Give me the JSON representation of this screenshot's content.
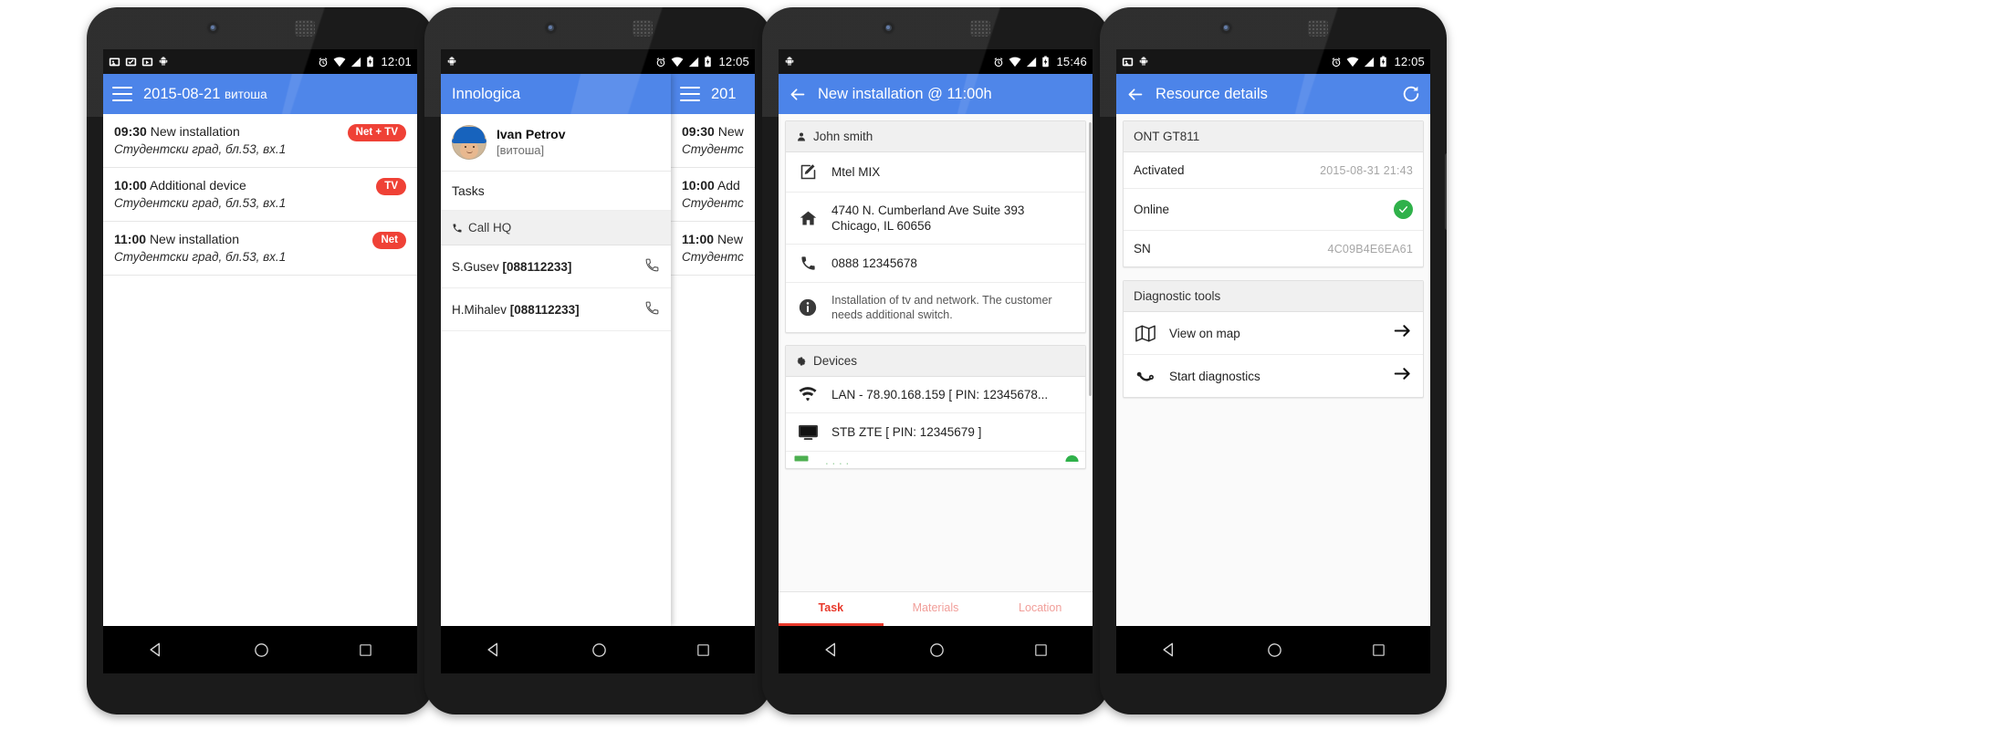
{
  "phones": [
    {
      "id": "tasks-list",
      "status": {
        "clock": "12:01",
        "left_icons": [
          "photo-icon",
          "photo-check-icon",
          "photo-video-icon",
          "android-icon"
        ],
        "right_icons": [
          "alarm-icon",
          "wifi-icon",
          "signal-icon",
          "battery-charging-icon"
        ]
      },
      "appbar": {
        "menu": "menu-icon",
        "title": "2015-08-21",
        "subtitle": "витоша"
      },
      "tasks": [
        {
          "time": "09:30",
          "title": "New installation",
          "address": "Студентски град, бл.53, вх.1",
          "badge": "Net + TV"
        },
        {
          "time": "10:00",
          "title": "Additional device",
          "address": "Студентски град, бл.53, вх.1",
          "badge": "TV"
        },
        {
          "time": "11:00",
          "title": "New installation",
          "address": "Студентски град, бл.53, вх.1",
          "badge": "Net"
        }
      ]
    },
    {
      "id": "nav-drawer",
      "status": {
        "clock": "12:05"
      },
      "drawer": {
        "brand": "Innologica",
        "profile": {
          "name": "Ivan Petrov",
          "team": "[витоша]"
        },
        "items": [
          {
            "label": "Tasks"
          }
        ],
        "section": {
          "label": "Call HQ",
          "icon": "phone-icon"
        },
        "contacts": [
          {
            "name": "S.Gusev",
            "phone": "[088112233]"
          },
          {
            "name": "H.Mihalev",
            "phone": "[088112233]"
          }
        ]
      },
      "appbar": {
        "menu": "menu-icon",
        "title": "201"
      },
      "tasks": [
        {
          "time": "09:30",
          "title": "New",
          "address": "Студентс"
        },
        {
          "time": "10:00",
          "title": "Add",
          "address": "Студентс"
        },
        {
          "time": "11:00",
          "title": "New",
          "address": "Студентс"
        }
      ]
    },
    {
      "id": "task-detail",
      "status": {
        "clock": "15:46"
      },
      "appbar": {
        "back": "back-arrow-icon",
        "title": "New installation @ 11:00h"
      },
      "customer_card": {
        "header": {
          "label": "John smith",
          "icon": "person-icon"
        },
        "rows": [
          {
            "icon": "edit-icon",
            "text": "Mtel MIX"
          },
          {
            "icon": "home-icon",
            "text": "4740 N. Cumberland Ave Suite 393\nChicago, IL 60656"
          },
          {
            "icon": "phone-icon",
            "text": "0888 12345678"
          },
          {
            "icon": "info-icon",
            "text": "Installation of tv and network. The customer needs additional switch."
          }
        ]
      },
      "devices_card": {
        "header": {
          "label": "Devices",
          "icon": "gear-icon"
        },
        "rows": [
          {
            "icon": "wifi-icon",
            "text": "LAN - 78.90.168.159 [ PIN: 12345678..."
          },
          {
            "icon": "tv-icon",
            "text": "STB ZTE [ PIN: 12345679 ]"
          }
        ]
      },
      "tabs": [
        {
          "label": "Task",
          "active": true
        },
        {
          "label": "Materials",
          "active": false
        },
        {
          "label": "Location",
          "active": false
        }
      ]
    },
    {
      "id": "resource-details",
      "status": {
        "clock": "12:05"
      },
      "appbar": {
        "back": "back-arrow-icon",
        "title": "Resource details",
        "action": "refresh-icon"
      },
      "resource_card": {
        "header": "ONT GT811",
        "rows": [
          {
            "key": "Activated",
            "value": "2015-08-31 21:43",
            "type": "text"
          },
          {
            "key": "Online",
            "value": "",
            "type": "check"
          },
          {
            "key": "SN",
            "value": "4C09B4E6EA61",
            "type": "text"
          }
        ]
      },
      "tools_card": {
        "header": "Diagnostic tools",
        "rows": [
          {
            "icon": "map-icon",
            "label": "View on map"
          },
          {
            "icon": "diagnostics-icon",
            "label": "Start diagnostics"
          }
        ]
      }
    }
  ],
  "colors": {
    "accent": "#3b78e7",
    "badge": "#ef4136",
    "tab_active": "#e8392b",
    "online": "#2fb14a"
  }
}
